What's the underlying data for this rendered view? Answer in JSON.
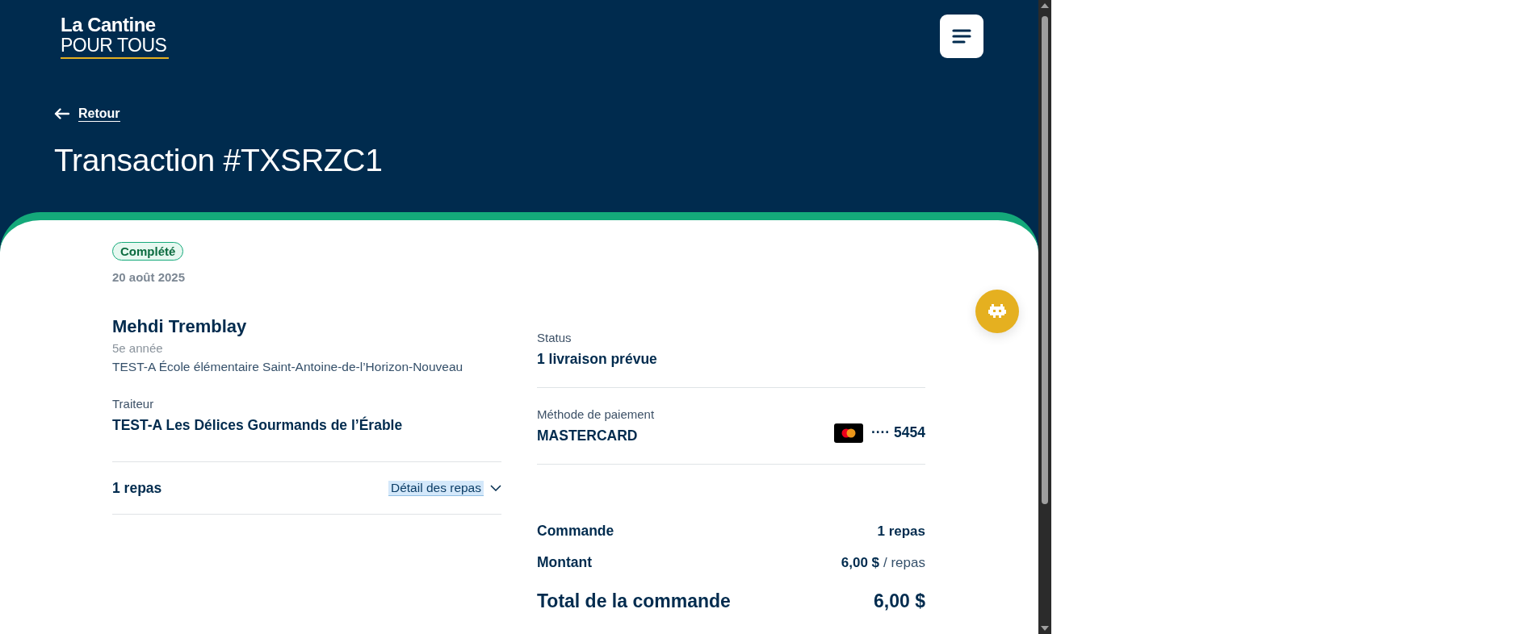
{
  "logo": {
    "line_1": "La Cantine",
    "line_2": "POUR TOUS"
  },
  "back_link": "Retour",
  "title": "Transaction #TXSRZC1",
  "status_badge": "Complété",
  "date": "20 août 2025",
  "student": {
    "name": "Mehdi Tremblay",
    "grade": "5e année",
    "school": "TEST-A École élémentaire Saint-Antoine-de-l’Horizon-Nouveau"
  },
  "caterer": {
    "label": "Traiteur",
    "name": "TEST-A Les Délices Gourmands de l’Érable"
  },
  "meals": {
    "count": "1 repas",
    "details_link": "Détail des repas",
    "expanded": false
  },
  "status": {
    "label": "Status",
    "value": "1 livraison prévue"
  },
  "payment": {
    "label": "Méthode de paiement",
    "method": "MASTERCARD",
    "card_number": "···· 5454"
  },
  "summary": [
    {
      "label": "Commande",
      "value": "1 repas"
    },
    {
      "label": "Montant",
      "value": "6,00 $",
      "unit": "/ repas"
    }
  ],
  "total": {
    "label": "Total de la commande",
    "value": "6,00 $"
  }
}
